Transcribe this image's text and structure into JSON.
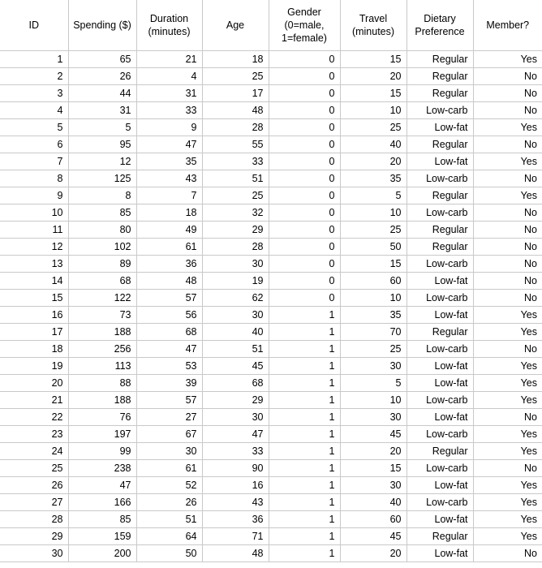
{
  "table": {
    "columns": [
      {
        "key": "id",
        "label": "ID"
      },
      {
        "key": "spending",
        "label": "Spending ($)"
      },
      {
        "key": "duration",
        "label": "Duration\n(minutes)"
      },
      {
        "key": "age",
        "label": "Age"
      },
      {
        "key": "gender",
        "label": "Gender\n(0=male,\n1=female)"
      },
      {
        "key": "travel",
        "label": "Travel\n(minutes)"
      },
      {
        "key": "diet",
        "label": "Dietary\nPreference"
      },
      {
        "key": "member",
        "label": "Member?"
      }
    ],
    "rows": [
      [
        "1",
        "65",
        "21",
        "18",
        "0",
        "15",
        "Regular",
        "Yes"
      ],
      [
        "2",
        "26",
        "4",
        "25",
        "0",
        "20",
        "Regular",
        "No"
      ],
      [
        "3",
        "44",
        "31",
        "17",
        "0",
        "15",
        "Regular",
        "No"
      ],
      [
        "4",
        "31",
        "33",
        "48",
        "0",
        "10",
        "Low-carb",
        "No"
      ],
      [
        "5",
        "5",
        "9",
        "28",
        "0",
        "25",
        "Low-fat",
        "Yes"
      ],
      [
        "6",
        "95",
        "47",
        "55",
        "0",
        "40",
        "Regular",
        "No"
      ],
      [
        "7",
        "12",
        "35",
        "33",
        "0",
        "20",
        "Low-fat",
        "Yes"
      ],
      [
        "8",
        "125",
        "43",
        "51",
        "0",
        "35",
        "Low-carb",
        "No"
      ],
      [
        "9",
        "8",
        "7",
        "25",
        "0",
        "5",
        "Regular",
        "Yes"
      ],
      [
        "10",
        "85",
        "18",
        "32",
        "0",
        "10",
        "Low-carb",
        "No"
      ],
      [
        "11",
        "80",
        "49",
        "29",
        "0",
        "25",
        "Regular",
        "No"
      ],
      [
        "12",
        "102",
        "61",
        "28",
        "0",
        "50",
        "Regular",
        "No"
      ],
      [
        "13",
        "89",
        "36",
        "30",
        "0",
        "15",
        "Low-carb",
        "No"
      ],
      [
        "14",
        "68",
        "48",
        "19",
        "0",
        "60",
        "Low-fat",
        "No"
      ],
      [
        "15",
        "122",
        "57",
        "62",
        "0",
        "10",
        "Low-carb",
        "No"
      ],
      [
        "16",
        "73",
        "56",
        "30",
        "1",
        "35",
        "Low-fat",
        "Yes"
      ],
      [
        "17",
        "188",
        "68",
        "40",
        "1",
        "70",
        "Regular",
        "Yes"
      ],
      [
        "18",
        "256",
        "47",
        "51",
        "1",
        "25",
        "Low-carb",
        "No"
      ],
      [
        "19",
        "113",
        "53",
        "45",
        "1",
        "30",
        "Low-fat",
        "Yes"
      ],
      [
        "20",
        "88",
        "39",
        "68",
        "1",
        "5",
        "Low-fat",
        "Yes"
      ],
      [
        "21",
        "188",
        "57",
        "29",
        "1",
        "10",
        "Low-carb",
        "Yes"
      ],
      [
        "22",
        "76",
        "27",
        "30",
        "1",
        "30",
        "Low-fat",
        "No"
      ],
      [
        "23",
        "197",
        "67",
        "47",
        "1",
        "45",
        "Low-carb",
        "Yes"
      ],
      [
        "24",
        "99",
        "30",
        "33",
        "1",
        "20",
        "Regular",
        "Yes"
      ],
      [
        "25",
        "238",
        "61",
        "90",
        "1",
        "15",
        "Low-carb",
        "No"
      ],
      [
        "26",
        "47",
        "52",
        "16",
        "1",
        "30",
        "Low-fat",
        "Yes"
      ],
      [
        "27",
        "166",
        "26",
        "43",
        "1",
        "40",
        "Low-carb",
        "Yes"
      ],
      [
        "28",
        "85",
        "51",
        "36",
        "1",
        "60",
        "Low-fat",
        "Yes"
      ],
      [
        "29",
        "159",
        "64",
        "71",
        "1",
        "45",
        "Regular",
        "Yes"
      ],
      [
        "30",
        "200",
        "50",
        "48",
        "1",
        "20",
        "Low-fat",
        "No"
      ]
    ]
  }
}
